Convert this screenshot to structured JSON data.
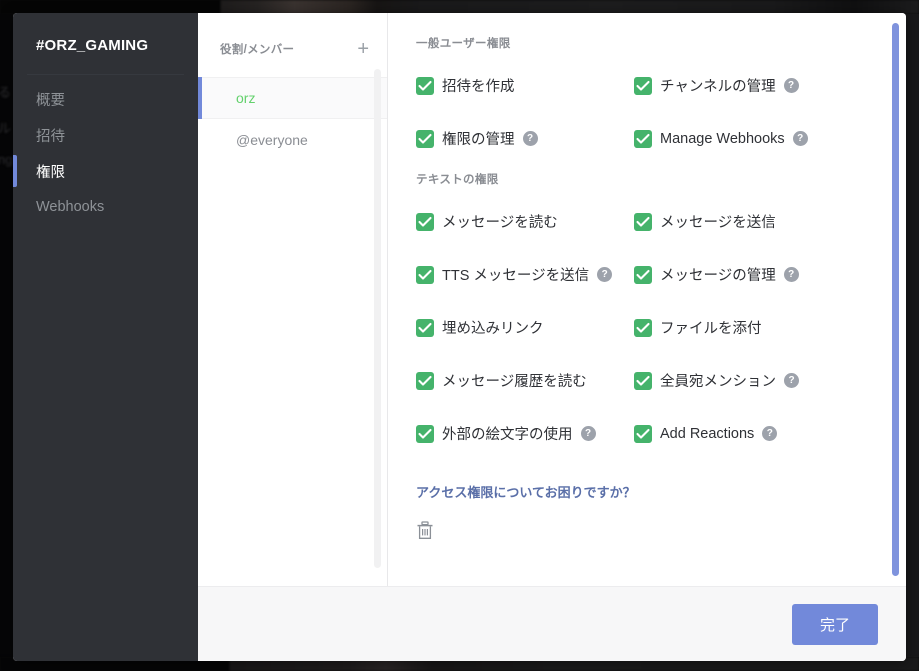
{
  "sidebar": {
    "title": "#ORZ_GAMING",
    "items": [
      {
        "label": "概要",
        "active": false
      },
      {
        "label": "招待",
        "active": false
      },
      {
        "label": "権限",
        "active": true
      },
      {
        "label": "Webhooks",
        "active": false
      }
    ]
  },
  "roles": {
    "header_label": "役割/メンバー",
    "add_icon": "plus-icon",
    "items": [
      {
        "name": "orz",
        "selected": true,
        "color": "#63d16c"
      },
      {
        "name": "@everyone",
        "selected": false,
        "color": "#8a8d93"
      }
    ]
  },
  "permissions": {
    "sections": [
      {
        "title": "一般ユーザー権限",
        "items": [
          {
            "label": "招待を作成",
            "checked": true,
            "help": false
          },
          {
            "label": "チャンネルの管理",
            "checked": true,
            "help": true
          },
          {
            "label": "権限の管理",
            "checked": true,
            "help": true
          },
          {
            "label": "Manage Webhooks",
            "checked": true,
            "help": true
          }
        ]
      },
      {
        "title": "テキストの権限",
        "items": [
          {
            "label": "メッセージを読む",
            "checked": true,
            "help": false
          },
          {
            "label": "メッセージを送信",
            "checked": true,
            "help": false
          },
          {
            "label": "TTS メッセージを送信",
            "checked": true,
            "help": true
          },
          {
            "label": "メッセージの管理",
            "checked": true,
            "help": true
          },
          {
            "label": "埋め込みリンク",
            "checked": true,
            "help": false
          },
          {
            "label": "ファイルを添付",
            "checked": true,
            "help": false
          },
          {
            "label": "メッセージ履歴を読む",
            "checked": true,
            "help": false
          },
          {
            "label": "全員宛メンション",
            "checked": true,
            "help": true
          },
          {
            "label": "外部の絵文字の使用",
            "checked": true,
            "help": true
          },
          {
            "label": "Add Reactions",
            "checked": true,
            "help": true
          }
        ]
      }
    ],
    "help_link": "アクセス権限についてお困りですか？",
    "delete_icon": "trash-icon",
    "help_glyph": "?"
  },
  "footer": {
    "done_label": "完了"
  },
  "colors": {
    "accent": "#7289da",
    "checkbox_green": "#45b36b",
    "role_green": "#63d16c",
    "sidebar_bg": "#2f3136",
    "link_blue": "#5a6fa8"
  },
  "backdrop": {
    "ghost_texts": [
      "る",
      "ル",
      "ng"
    ]
  }
}
